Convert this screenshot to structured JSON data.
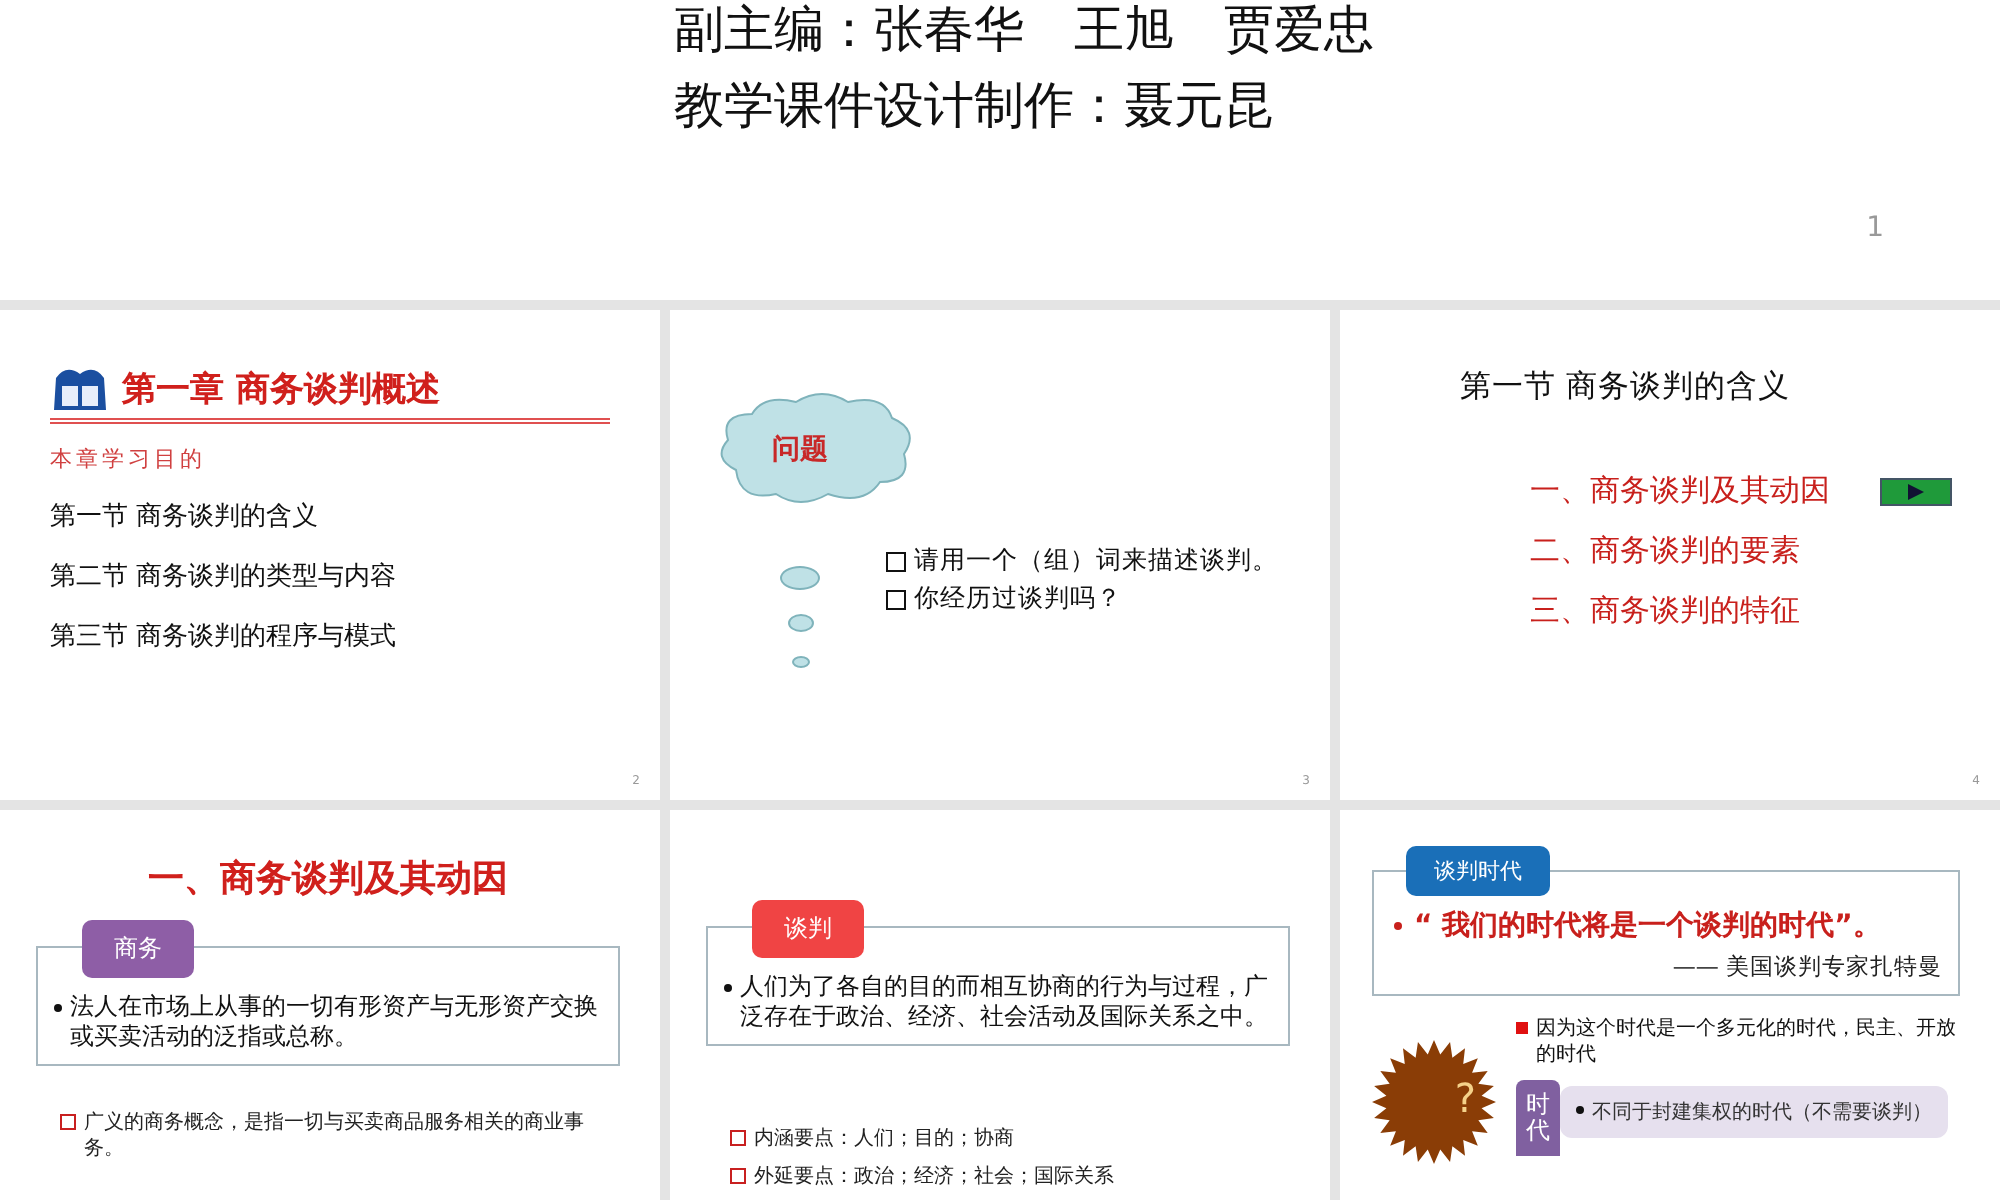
{
  "slides": [
    {
      "kind": "title",
      "number": "1",
      "lines": [
        "副主编：张春华　王旭　贾爱忠",
        "教学课件设计制作：聂元昆"
      ]
    },
    {
      "kind": "chapter",
      "number": "2",
      "title": "第一章  商务谈判概述",
      "subtitle": "本章学习目的",
      "items": [
        "第一节  商务谈判的含义",
        "第二节  商务谈判的类型与内容",
        "第三节  商务谈判的程序与模式"
      ]
    },
    {
      "kind": "question",
      "number": "3",
      "cloud": "问题",
      "items": [
        "请用一个（组）词来描述谈判。",
        "你经历过谈判吗？"
      ]
    },
    {
      "kind": "section",
      "number": "4",
      "title": "第一节  商务谈判的含义",
      "items": [
        "一、商务谈判及其动因",
        "二、商务谈判的要素",
        "三、商务谈判的特征"
      ]
    },
    {
      "kind": "definition",
      "title": "一、商务谈判及其动因",
      "tag": "商务",
      "color": "#8e5ea6",
      "body": "法人在市场上从事的一切有形资产与无形资产交换或买卖活动的泛指或总称。",
      "items": [
        "广义的商务概念，是指一切与买卖商品服务相关的商业事务。"
      ]
    },
    {
      "kind": "definition",
      "tag": "谈判",
      "color": "#f04444",
      "body": "人们为了各自的目的而相互协商的行为与过程，广泛存在于政治、经济、社会活动及国际关系之中。",
      "items": [
        "内涵要点：人们；目的；协商",
        "外延要点：政治；经济；社会；国际关系"
      ]
    },
    {
      "kind": "era",
      "tag": "谈判时代",
      "color": "#1a6fb8",
      "quote": "“ 我们的时代将是一个谈判的时代”。",
      "source": "—— 美国谈判专家扎特曼",
      "mark": "?",
      "point": "因为这个时代是一个多元化的时代，民主、开放的时代",
      "side": "时代",
      "side_item": "不同于封建集权的时代（不需要谈判）"
    }
  ]
}
